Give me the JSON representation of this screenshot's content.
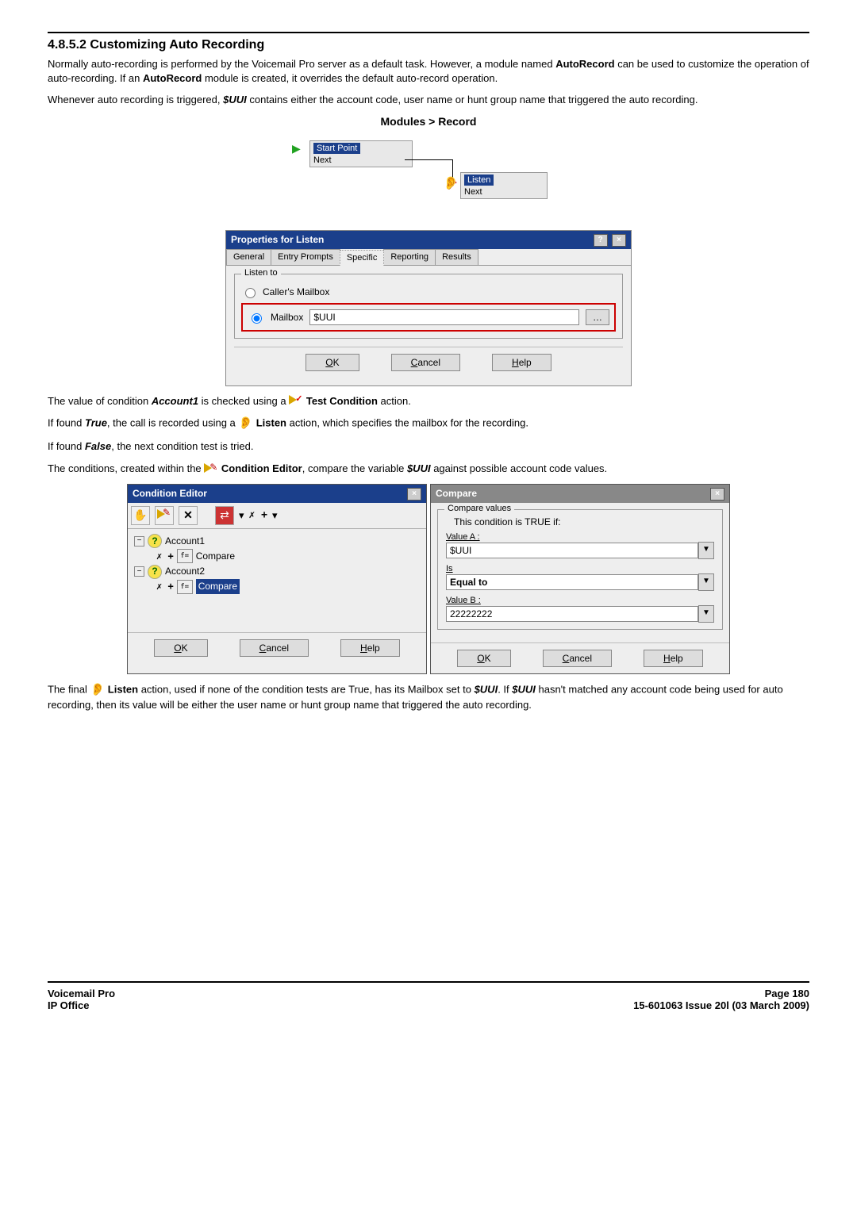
{
  "heading": "4.8.5.2 Customizing Auto Recording",
  "para1_a": "Normally auto-recording is performed by the Voicemail Pro server as a default task. However, a module named ",
  "para1_b": "AutoRecord",
  "para1_c": " can be used to customize the operation of auto-recording. If an ",
  "para1_d": "AutoRecord",
  "para1_e": " module is created, it overrides the default auto-record operation.",
  "para2_a": "Whenever auto recording is triggered, ",
  "para2_b": "$UUI",
  "para2_c": " contains either the account code, user name or hunt group name that triggered the auto recording.",
  "flowchart": {
    "title": "Modules > Record",
    "start_label": "Start Point",
    "start_next": "Next",
    "listen_label": "Listen",
    "listen_next": "Next"
  },
  "properties_dialog": {
    "title": "Properties for Listen",
    "tabs": [
      "General",
      "Entry Prompts",
      "Specific",
      "Reporting",
      "Results"
    ],
    "fieldset_legend": "Listen to",
    "radio_callers": "Caller's Mailbox",
    "radio_mailbox": "Mailbox",
    "mailbox_value": "$UUI",
    "ok": "OK",
    "cancel": "Cancel",
    "help": "Help"
  },
  "para3_a": "The value of condition ",
  "para3_b": "Account1",
  "para3_c": " is checked using a ",
  "para3_d": "Test Condition",
  "para3_e": " action.",
  "para4_a": "If found ",
  "para4_b": "True",
  "para4_c": ", the call is recorded using a ",
  "para4_d": "Listen",
  "para4_e": " action, which specifies the mailbox for the recording.",
  "para5_a": "If found ",
  "para5_b": "False",
  "para5_c": ", the next condition test is tried.",
  "para6_a": "The conditions, created within the ",
  "para6_b": "Condition Editor",
  "para6_c": ", compare the variable ",
  "para6_d": "$UUI",
  "para6_e": " against possible account code values.",
  "cond_editor": {
    "title": "Condition Editor",
    "tree": {
      "acct1": "Account1",
      "compare1": "Compare",
      "acct2": "Account2",
      "compare2": "Compare"
    },
    "ok": "OK",
    "cancel": "Cancel",
    "help": "Help"
  },
  "compare_dlg": {
    "title": "Compare",
    "legend": "Compare values",
    "subtitle": "This condition is TRUE if:",
    "valA_label": "Value A :",
    "valA": "$UUI",
    "is_label": "Is",
    "op": "Equal to",
    "valB_label": "Value B :",
    "valB": "22222222",
    "ok": "OK",
    "cancel": "Cancel",
    "help": "Help"
  },
  "para7_a": "The final ",
  "para7_b": "Listen",
  "para7_c": " action, used if none of the condition tests are True, has its Mailbox set to ",
  "para7_d": "$UUI",
  "para7_e": ". If ",
  "para7_f": "$UUI",
  "para7_g": " hasn't matched any account code being used for auto recording, then its value will be either the user name or hunt group name that triggered the auto recording.",
  "footer": {
    "left1": "Voicemail Pro",
    "left2": "IP Office",
    "right1": "Page 180",
    "right2": "15-601063 Issue 20l (03 March 2009)"
  }
}
